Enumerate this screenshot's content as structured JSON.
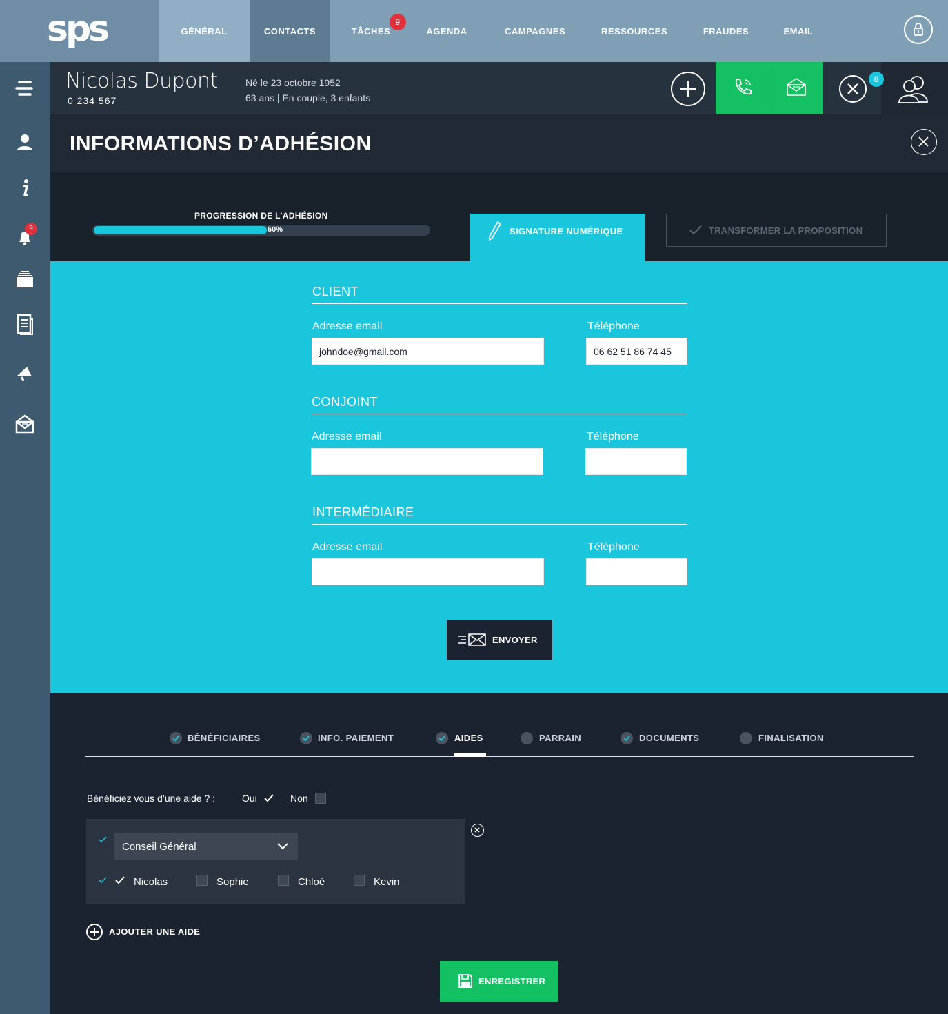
{
  "topnav": {
    "logo": "sps",
    "items": [
      {
        "label": "GÉNÉRAL"
      },
      {
        "label": "CONTACTS"
      },
      {
        "label": "TÂCHES",
        "badge": "9"
      },
      {
        "label": "AGENDA"
      },
      {
        "label": "CAMPAGNES"
      },
      {
        "label": "RESSOURCES"
      },
      {
        "label": "FRAUDES"
      },
      {
        "label": "EMAIL"
      }
    ]
  },
  "sidebar": {
    "icons": [
      "menu-icon",
      "user-icon",
      "info-icon",
      "bell-icon",
      "folder-icon",
      "document-icon",
      "megaphone-icon",
      "mail-icon"
    ],
    "notification_badge": "9"
  },
  "contact": {
    "name": "Nicolas Dupont",
    "id": "0 234 567",
    "birth": "Né le 23 octobre 1952",
    "details": "63 ans  |  En couple, 3 enfants",
    "users_badge": "8"
  },
  "modal": {
    "title": "INFORMATIONS D’ADHÉSION",
    "progress_label": "PROGRESSION DE L’ADHÉSION",
    "progress_value": 0.6,
    "progress_text": "60%",
    "signature_tab": "SIGNATURE NUMÉRIQUE",
    "transform_button": "TRANSFORMER LA PROPOSITION"
  },
  "form": {
    "sections": [
      {
        "title": "CLIENT",
        "email_label": "Adresse email",
        "email_value": "johndoe@gmail.com",
        "phone_label": "Téléphone",
        "phone_value": "06 62 51 86 74 45"
      },
      {
        "title": "CONJOINT",
        "email_label": "Adresse email",
        "email_value": "",
        "phone_label": "Téléphone",
        "phone_value": ""
      },
      {
        "title": "INTERMÉDIAIRE",
        "email_label": "Adresse email",
        "email_value": "",
        "phone_label": "Téléphone",
        "phone_value": ""
      }
    ],
    "send_button": "ENVOYER"
  },
  "steps": [
    {
      "label": "BÉNÉFICIAIRES",
      "done": true
    },
    {
      "label": "INFO. PAIEMENT",
      "done": true
    },
    {
      "label": "AIDES",
      "done": true,
      "active": true
    },
    {
      "label": "PARRAIN",
      "done": false
    },
    {
      "label": "DOCUMENTS",
      "done": true
    },
    {
      "label": "FINALISATION",
      "done": false
    }
  ],
  "aides": {
    "question": "Bénéficiez vous d’une aide ? :",
    "yes_label": "Oui",
    "yes_checked": true,
    "no_label": "Non",
    "no_checked": false,
    "selected_aide": "Conseil Général",
    "persons": [
      {
        "name": "Nicolas",
        "checked": true
      },
      {
        "name": "Sophie",
        "checked": false
      },
      {
        "name": "Chloé",
        "checked": false
      },
      {
        "name": "Kevin",
        "checked": false
      }
    ],
    "add_label": "AJOUTER UNE AIDE",
    "save_button": "ENREGISTRER"
  },
  "colors": {
    "accent": "#1ac6dc",
    "green": "#13c162",
    "nav": "#7f9fb5",
    "sidebar": "#3e5a6e",
    "dark": "#1b2330",
    "badge": "#e0313d"
  }
}
